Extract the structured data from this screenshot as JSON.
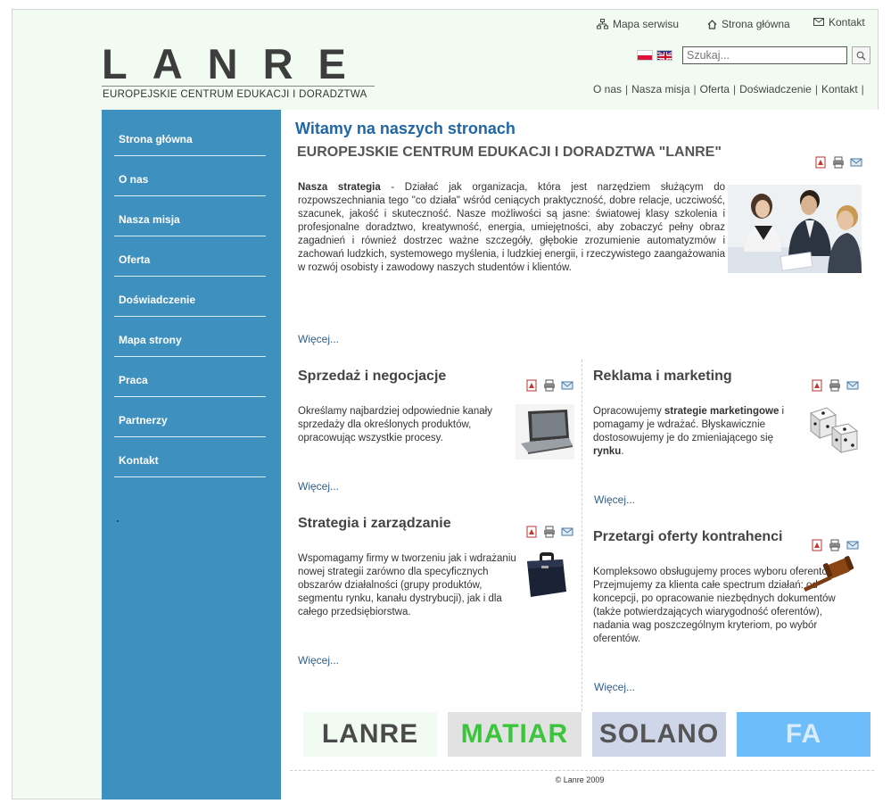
{
  "top_links": {
    "sitemap": "Mapa serwisu",
    "home": "Strona główna",
    "contact": "Kontakt"
  },
  "logo": {
    "title": "LANRE",
    "subtitle": "EUROPEJSKIE CENTRUM EDUKACJI I DORADZTWA"
  },
  "search": {
    "placeholder": "Szukaj..."
  },
  "subnav": [
    "O nas",
    "Nasza misja",
    "Oferta",
    "Doświadczenie",
    "Kontakt"
  ],
  "sidebar": {
    "items": [
      {
        "label": "Strona główna"
      },
      {
        "label": "O nas"
      },
      {
        "label": "Nasza misja"
      },
      {
        "label": "Oferta"
      },
      {
        "label": "Doświadczenie"
      },
      {
        "label": "Mapa strony"
      },
      {
        "label": "Praca"
      },
      {
        "label": "Partnerzy"
      },
      {
        "label": "Kontakt"
      }
    ],
    "dot": "."
  },
  "main": {
    "title": "Witamy na naszych stronach",
    "subtitle": "EUROPEJSKIE CENTRUM EDUKACJI I DORADZTWA \"LANRE\"",
    "intro_strong": "Nasza strategia",
    "intro_text": " - Działać jak organizacja, która jest narzędziem służącym do rozpowszechniania tego \"co działa\" wśród ceniących praktyczność, dobre relacje, uczciwość, szacunek, jakość i skuteczność. Nasze możliwości są jasne: światowej klasy szkolenia i profesjonalne doradztwo, kreatywność, energia, umiejętności, aby zobaczyć pełny obraz zagadnień i równieź dostrzec ważne szczegóły, głębokie zrozumienie automatyzmów i zachowań ludzkich, systemowego myślenia, i ludzkiej energii, i rzeczywistego zaangażowania w rozwój osobisty i zawodowy naszych studentów i klientów.",
    "more": "Więcej..."
  },
  "sections": [
    {
      "title": "Sprzedaż i negocjacje",
      "text": "Określamy najbardziej odpowiednie kanały sprzedaży dla określonych produktów, opracowując wszystkie procesy.",
      "more": "Więcej..."
    },
    {
      "title": "Reklama i marketing",
      "text_a": "Opracowujemy ",
      "text_b": "strategie marketingowe",
      "text_c": " i pomagamy je wdrażać. Błyskawicznie dostosowujemy je do zmieniającego się ",
      "text_d": "rynku",
      "text_e": ".",
      "more": "Więcej..."
    },
    {
      "title": "Strategia i zarządzanie",
      "text": "Wspomagamy firmy w tworzeniu jak i wdrażaniu nowej strategii zarówno dla specyficznych obszarów działalności (grupy produktów, segmentu rynku, kanału dystrybucji), jak i dla całego przedsiębiorstwa.",
      "more": "Więcej..."
    },
    {
      "title": "Przetargi oferty kontrahenci",
      "text": "Kompleksowo obsługujemy proces wyboru oferentów. Przejmujemy za klienta całe spectrum działań: od koncepcji, po opracowanie niezbędnych dokumentów (także potwierdzających wiarygodność oferentów), nadania wag poszczególnym kryteriom, po wybór oferentów.",
      "more": "Więcej..."
    }
  ],
  "banners": [
    "LANRE",
    "MATIAR",
    "SOLANO",
    "FA"
  ],
  "footer": "© Lanre 2009",
  "colors": {
    "sidebar": "#3e90bf",
    "title_blue": "#2067a8",
    "page_bg": "#f2fbf2",
    "matiar_green": "#3cc43c",
    "fa_blue": "#6cbdf9"
  }
}
